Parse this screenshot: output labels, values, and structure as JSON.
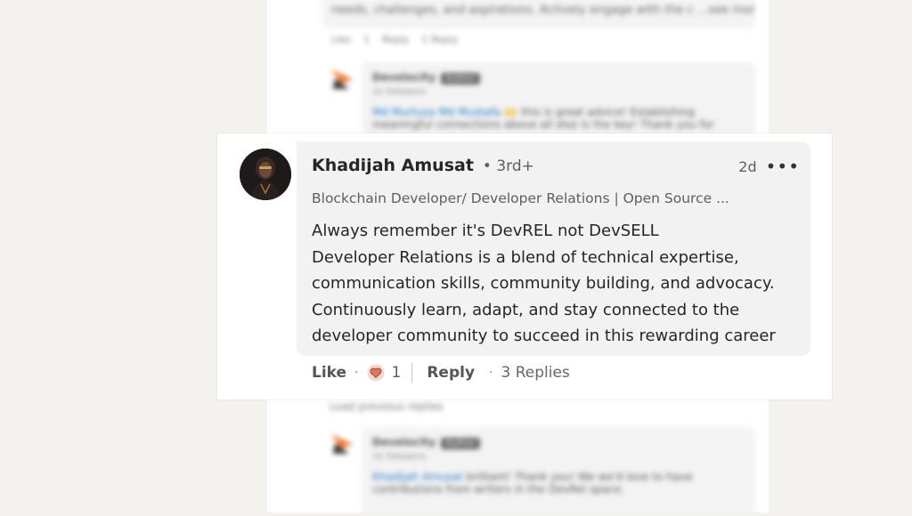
{
  "background": {
    "top_comment_text": "needs, challenges, and aspirations. Actively engage with the c ...see more",
    "top_actions": {
      "like": "Like",
      "like_count": "1",
      "reply": "Reply",
      "replies": "1 Reply"
    },
    "reply1": {
      "author": "Develocity",
      "badge": "Author",
      "followers": "1k followers",
      "mention": "Md Murtuza Md Mustafa",
      "emoji": "🙌",
      "text": "this is great advice! Establishing",
      "text2": "meaningful connections above all else is the key! Thank you for"
    },
    "load_previous": "Load previous replies",
    "reply2": {
      "author": "Develocity",
      "badge": "Author",
      "followers": "1k followers",
      "mention": "Khadijah Amusat",
      "text": "brilliant! Thank you! We we'd love to have",
      "text2": "contributions from writers in the DevRel space."
    }
  },
  "comment": {
    "author_name": "Khadijah Amusat",
    "degree": "• 3rd+",
    "headline": "Blockchain Developer/ Developer Relations | Open Source ...",
    "time": "2d",
    "more_icon": "more-dots-icon",
    "lines": [
      "Always remember it's DevREL not DevSELL",
      "Developer Relations is a blend of technical expertise,",
      "communication skills, community building, and advocacy.",
      "Continuously learn, adapt, and stay connected to the",
      "developer community to succeed in this rewarding career"
    ],
    "actions": {
      "like": "Like",
      "separator": "·",
      "reaction_icon": "heart-reaction-icon",
      "reaction_count": "1",
      "reply": "Reply",
      "replies": "3 Replies"
    }
  },
  "colors": {
    "page_bg": "#f3f2ef",
    "bubble_bg": "#f2f2f2",
    "text": "#262626",
    "muted": "#5e5e5e",
    "heart": "#e7735c",
    "link": "#0a66c2",
    "logo_orange": "#f26d21"
  }
}
